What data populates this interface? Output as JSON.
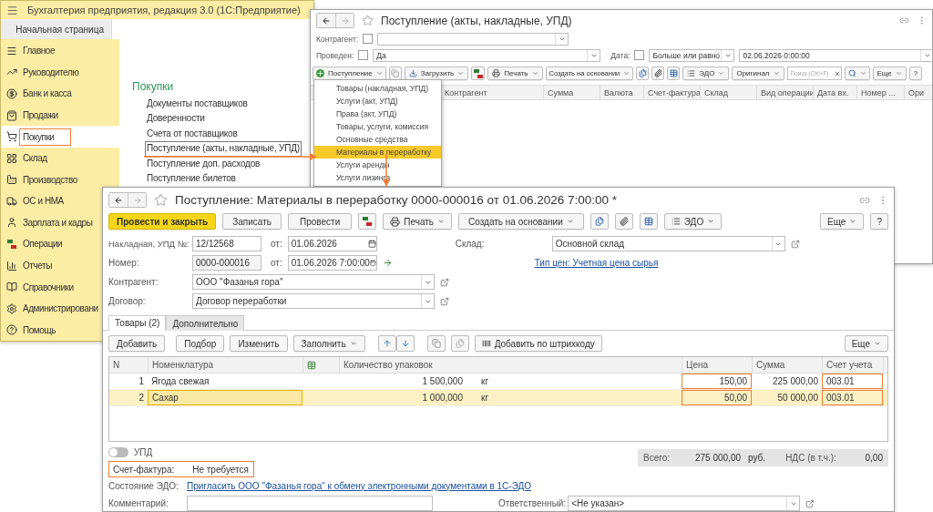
{
  "main_window": {
    "title": "Бухгалтерия предприятия, редакция 3.0  (1С:Предприятие)",
    "home_tab": "Начальная страница",
    "sidebar": [
      {
        "label": "Главное",
        "selected": false,
        "highlighted": false
      },
      {
        "label": "Руководителю",
        "selected": false,
        "highlighted": false
      },
      {
        "label": "Банк и касса",
        "selected": false,
        "highlighted": false
      },
      {
        "label": "Продажи",
        "selected": false,
        "highlighted": false
      },
      {
        "label": "Покупки",
        "selected": true,
        "highlighted": true
      },
      {
        "label": "Склад",
        "selected": false,
        "highlighted": false
      },
      {
        "label": "Производство",
        "selected": false,
        "highlighted": false
      },
      {
        "label": "ОС и НМА",
        "selected": false,
        "highlighted": false
      },
      {
        "label": "Зарплата и кадры",
        "selected": false,
        "highlighted": false
      },
      {
        "label": "Операции",
        "selected": false,
        "highlighted": false
      },
      {
        "label": "Отчеты",
        "selected": false,
        "highlighted": false
      },
      {
        "label": "Справочники",
        "selected": false,
        "highlighted": false
      },
      {
        "label": "Администрировани",
        "selected": false,
        "highlighted": false
      },
      {
        "label": "Помощь",
        "selected": false,
        "highlighted": false
      }
    ],
    "section_title": "Покупки",
    "links": [
      {
        "label": "Документы поставщиков",
        "focused": false
      },
      {
        "label": "Доверенности",
        "focused": false
      },
      {
        "label": "Счета от поставщиков",
        "focused": false
      },
      {
        "label": "Поступление (акты, накладные, УПД)",
        "focused": true
      },
      {
        "label": "Поступление доп. расходов",
        "focused": false
      },
      {
        "label": "Поступление билетов",
        "focused": false
      }
    ]
  },
  "list_window": {
    "title": "Поступление (акты, накладные, УПД)",
    "filters": {
      "counterparty": {
        "label": "Контрагент:",
        "checked": false
      },
      "posted": {
        "label": "Проведен:",
        "checked": false,
        "value": "Да"
      },
      "date": {
        "label": "Дата:",
        "checked": false,
        "condition": "Больше или равно",
        "value": "02.06.2026  0:00:00"
      }
    },
    "toolbar": {
      "create": "Поступление",
      "load": "Загрузить",
      "print": "Печать",
      "based_on": "Создать на основании",
      "edo": "ЭДО",
      "original": "Оригинал",
      "search_placeholder": "Поиск (Ctrl+F)",
      "more": "Еще",
      "help": "?"
    },
    "columns": [
      "Контрагент",
      "Сумма",
      "Валюта",
      "Счет-фактура",
      "Склад",
      "Вид операции",
      "Дата вх.",
      "Номер ...",
      "Ори"
    ],
    "menu": [
      {
        "label": "Товары (накладная, УПД)",
        "selected": false
      },
      {
        "label": "Услуги (акт, УПД)",
        "selected": false
      },
      {
        "label": "Права (акт, УПД)",
        "selected": false
      },
      {
        "label": "Товары, услуги, комиссия",
        "selected": false
      },
      {
        "label": "Основные средства",
        "selected": false
      },
      {
        "label": "Материалы в переработку",
        "selected": true
      },
      {
        "label": "Услуги аренды",
        "selected": false
      },
      {
        "label": "Услуги лизинга",
        "selected": false
      }
    ]
  },
  "doc_window": {
    "title": "Поступление: Материалы в переработку 0000-000016 от 01.06.2026 7:00:00 *",
    "toolbar": {
      "post_close": "Провести и закрыть",
      "save": "Записать",
      "post": "Провести",
      "print": "Печать",
      "based_on": "Создать на основании",
      "edo": "ЭДО",
      "more": "Еще",
      "help": "?"
    },
    "invoice_no": {
      "label": "Накладная, УПД №:",
      "value": "12/12568",
      "date_label": "от:",
      "date": "01.06.2026"
    },
    "number": {
      "label": "Номер:",
      "value": "0000-000016",
      "date_label": "от:",
      "date": "01.06.2026  7:00:00"
    },
    "warehouse": {
      "label": "Склад:",
      "value": "Основной склад"
    },
    "price_type_link": "Тип цен: Учетная цена сырья",
    "counterparty": {
      "label": "Контрагент:",
      "value": "ООО \"Фазанья гора\""
    },
    "contract": {
      "label": "Договор:",
      "value": "Договор переработки"
    },
    "tabs": [
      {
        "label": "Товары (2)",
        "selected": true
      },
      {
        "label": "Дополнительно",
        "selected": false
      }
    ],
    "table_toolbar": {
      "add": "Добавить",
      "pick": "Подбор",
      "edit": "Изменить",
      "fill": "Заполнить",
      "barcode": "Добавить по штрихкоду",
      "more": "Еще"
    },
    "columns": {
      "n": "N",
      "item": "Номенклатура",
      "qty": "Количество упаковок",
      "price": "Цена",
      "sum": "Сумма",
      "account": "Счет учета"
    },
    "rows": [
      {
        "n": "1",
        "item": "Ягода свежая",
        "qty": "1 500,000",
        "unit": "кг",
        "price": "150,00",
        "sum": "225 000,00",
        "account": "003.01",
        "selected": false
      },
      {
        "n": "2",
        "item": "Сахар",
        "qty": "1 000,000",
        "unit": "кг",
        "price": "50,00",
        "sum": "50 000,00",
        "account": "003.01",
        "selected": true
      }
    ],
    "upd": {
      "label": "УПД",
      "on": false
    },
    "totals": {
      "total_label": "Всего:",
      "total": "275 000,00",
      "currency": "руб.",
      "vat_label": "НДС (в т.ч.):",
      "vat": "0,00"
    },
    "invoice": {
      "label": "Счет-фактура:",
      "value": "Не требуется",
      "highlighted": true
    },
    "edo": {
      "label": "Состояние ЭДО:",
      "link": "Пригласить ООО \"Фазанья гора\" к обмену электронными документами в 1С-ЭДО"
    },
    "comment": {
      "label": "Комментарий:"
    },
    "responsible": {
      "label": "Ответственный:",
      "value": "<Не указан>"
    }
  }
}
